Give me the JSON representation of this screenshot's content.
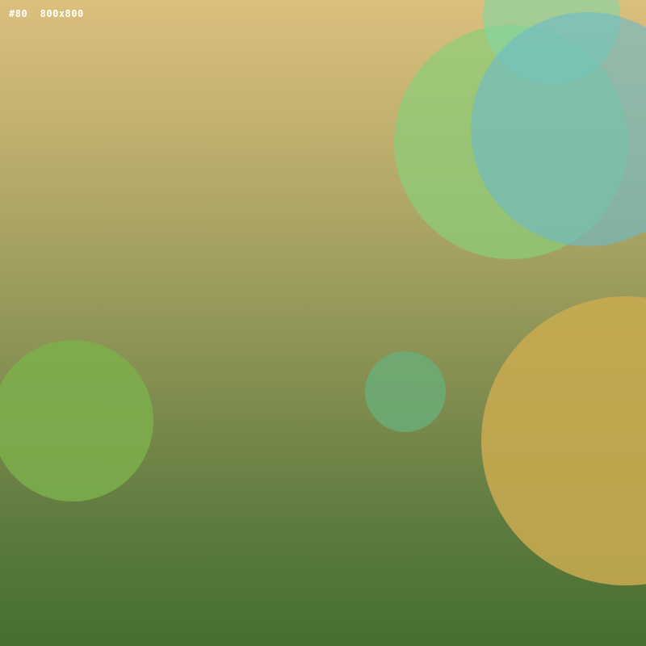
{
  "label": {
    "id_text": "#80",
    "size_text": "800x800"
  },
  "colors": {
    "background_top": "#dbbf7d",
    "background_bottom": "#46702f",
    "circle_green_large": "rgba(140,205,120,0.72)",
    "circle_mint_small": "rgba(130,215,165,0.62)",
    "circle_teal_large": "rgba(110,185,200,0.62)",
    "circle_green_left": "rgba(125,175,75,0.85)",
    "circle_teal_center": "rgba(105,175,120,0.80)",
    "circle_gold_right": "rgba(200,170,80,0.88)"
  }
}
